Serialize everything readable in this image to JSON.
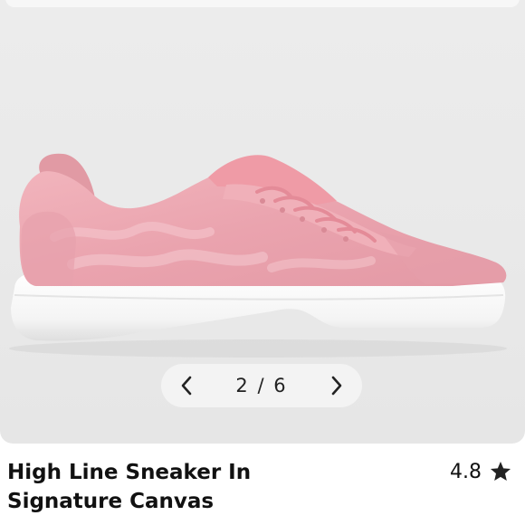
{
  "gallery": {
    "current_index": 2,
    "total": 6,
    "counter_text": "2 / 6",
    "prev_icon": "chevron-left-icon",
    "next_icon": "chevron-right-icon",
    "image_subject": "pink low-top sneaker with white sole"
  },
  "product": {
    "title_line1": "High Line Sneaker In",
    "title_line2": "Signature Canvas",
    "rating": "4.8",
    "rating_icon": "star-icon"
  },
  "colors": {
    "gallery_bg": "#ebebeb",
    "shoe_pink": "#e8a3ad",
    "sole_white": "#f6f6f6",
    "text": "#111111"
  }
}
